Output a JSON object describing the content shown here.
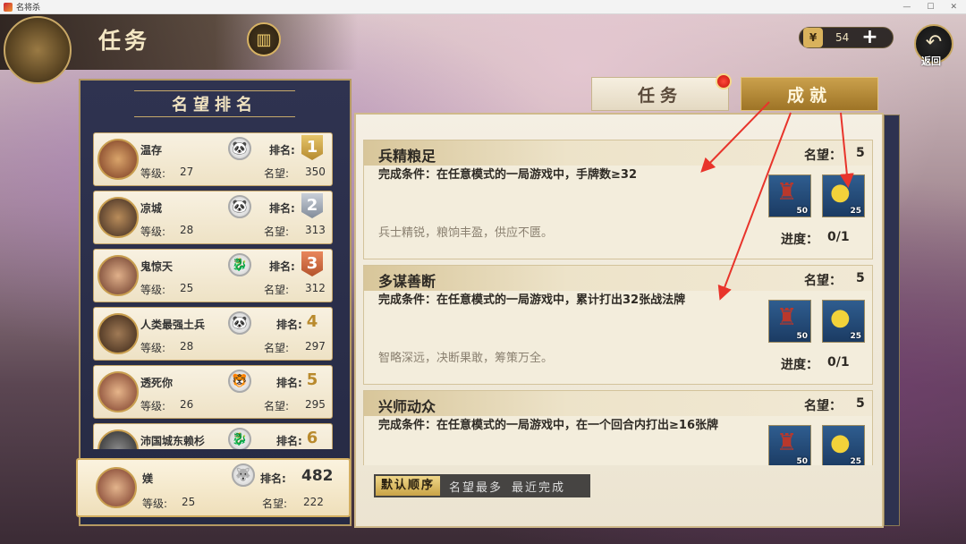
{
  "window": {
    "title": "名将杀"
  },
  "header": {
    "title": "任务",
    "currency_value": "54",
    "back_label": "返回"
  },
  "tabs": [
    {
      "label": "任务"
    },
    {
      "label": "成就"
    }
  ],
  "ranking": {
    "title": "名望排名",
    "rank_label": "排名:",
    "level_label": "等级:",
    "fame_label": "名望:",
    "entries": [
      {
        "name": "温存",
        "rank": "1",
        "level": "27",
        "fame": "350"
      },
      {
        "name": "凉城",
        "rank": "2",
        "level": "28",
        "fame": "313"
      },
      {
        "name": "鬼惊天",
        "rank": "3",
        "level": "25",
        "fame": "312"
      },
      {
        "name": "人类最强土兵",
        "rank": "4",
        "level": "28",
        "fame": "297"
      },
      {
        "name": "透死你",
        "rank": "5",
        "level": "26",
        "fame": "295"
      },
      {
        "name": "沛国城东赖杉",
        "rank": "6",
        "level": "",
        "fame": ""
      }
    ],
    "me": {
      "name": "媄",
      "rank": "482",
      "level": "25",
      "fame": "222"
    }
  },
  "tasks": {
    "fame_label": "名望：",
    "progress_label": "进度：",
    "items": [
      {
        "title": "兵精粮足",
        "fame": "5",
        "condition": "完成条件：在任意模式的一局游戏中，手牌数≥32",
        "flavor": "兵士精锐，粮饷丰盈，供应不匮。",
        "progress": "0/1",
        "rewards": [
          {
            "icon": "cart-icon",
            "count": "50"
          },
          {
            "icon": "gold-coins-icon",
            "count": "25"
          }
        ]
      },
      {
        "title": "多谋善断",
        "fame": "5",
        "condition": "完成条件：在任意模式的一局游戏中，累计打出32张战法牌",
        "flavor": "智略深远，决断果敢，筹策万全。",
        "progress": "0/1",
        "rewards": [
          {
            "icon": "cart-icon",
            "count": "50"
          },
          {
            "icon": "gold-coins-icon",
            "count": "25"
          }
        ]
      },
      {
        "title": "兴师动众",
        "fame": "5",
        "condition": "完成条件：在任意模式的一局游戏中，在一个回合内打出≥16张牌",
        "flavor": "",
        "progress": "",
        "rewards": [
          {
            "icon": "cart-icon",
            "count": "50"
          },
          {
            "icon": "gold-coins-icon",
            "count": "25"
          }
        ]
      }
    ]
  },
  "sort": {
    "default": "默认顺序",
    "by_fame": "名望最多",
    "recent": "最近完成"
  },
  "colors": {
    "accent_gold": "#c9a346",
    "annotation_red": "#e8342b",
    "panel_navy": "#2f3350"
  }
}
